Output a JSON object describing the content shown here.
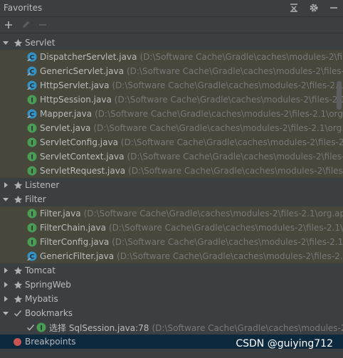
{
  "window": {
    "title": "Favorites"
  },
  "icons": {
    "title": [
      "collapse-all-icon",
      "gear-icon",
      "minimize-icon"
    ],
    "toolbar": [
      "add-icon",
      "edit-icon",
      "remove-icon"
    ]
  },
  "colors": {
    "background": "#3c3f41",
    "selection": "#47473b",
    "highlight": "#0d293e",
    "star": "#afb1b3",
    "class_icon": "#3592c4",
    "interface_icon": "#499c54",
    "breakpoint": "#c75450"
  },
  "tree": {
    "servlet": {
      "label": "Servlet",
      "files": [
        {
          "name": "DispatcherServlet.java",
          "path": "(D:\\Software Cache\\Gradle\\caches\\modules-2\\file",
          "kind": "class"
        },
        {
          "name": "GenericServlet.java",
          "path": "(D:\\Software Cache\\Gradle\\caches\\modules-2\\files-2.",
          "kind": "class"
        },
        {
          "name": "HttpServlet.java",
          "path": "(D:\\Software Cache\\Gradle\\caches\\modules-2\\files-2.1\\",
          "kind": "class"
        },
        {
          "name": "HttpSession.java",
          "path": "(D:\\Software Cache\\Gradle\\caches\\modules-2\\files-2.1\\",
          "kind": "interface"
        },
        {
          "name": "Mapper.java",
          "path": "(D:\\Software Cache\\Gradle\\caches\\modules-2\\files-2.1\\org",
          "kind": "class"
        },
        {
          "name": "Servlet.java",
          "path": "(D:\\Software Cache\\Gradle\\caches\\modules-2\\files-2.1\\org.a",
          "kind": "interface"
        },
        {
          "name": "ServletConfig.java",
          "path": "(D:\\Software Cache\\Gradle\\caches\\modules-2\\files-2.",
          "kind": "interface"
        },
        {
          "name": "ServletContext.java",
          "path": "(D:\\Software Cache\\Gradle\\caches\\modules-2\\files-2.",
          "kind": "interface"
        },
        {
          "name": "ServletRequest.java",
          "path": "(D:\\Software Cache\\Gradle\\caches\\modules-2\\files-2",
          "kind": "interface"
        }
      ]
    },
    "listener": {
      "label": "Listener"
    },
    "filter": {
      "label": "Filter",
      "files": [
        {
          "name": "Filter.java",
          "path": "(D:\\Software Cache\\Gradle\\caches\\modules-2\\files-2.1\\org.ap",
          "kind": "interface"
        },
        {
          "name": "FilterChain.java",
          "path": "(D:\\Software Cache\\Gradle\\caches\\modules-2\\files-2.1\\c",
          "kind": "interface"
        },
        {
          "name": "FilterConfig.java",
          "path": "(D:\\Software Cache\\Gradle\\caches\\modules-2\\files-2.1",
          "kind": "interface"
        },
        {
          "name": "GenericFilter.java",
          "path": "(D:\\Software Cache\\Gradle\\caches\\modules-2\\files-2.1",
          "kind": "class"
        }
      ]
    },
    "tomcat": {
      "label": "Tomcat"
    },
    "springweb": {
      "label": "SpringWeb"
    },
    "mybatis": {
      "label": "Mybatis"
    },
    "bookmarks": {
      "label": "Bookmarks",
      "item": {
        "name": "选择 SqlSession.java:78",
        "path": "(D:\\Software Cache\\Gradle\\caches\\modules-2"
      }
    },
    "breakpoints": {
      "label": "Breakpoints"
    }
  },
  "watermark": "CSDN @guiying712"
}
